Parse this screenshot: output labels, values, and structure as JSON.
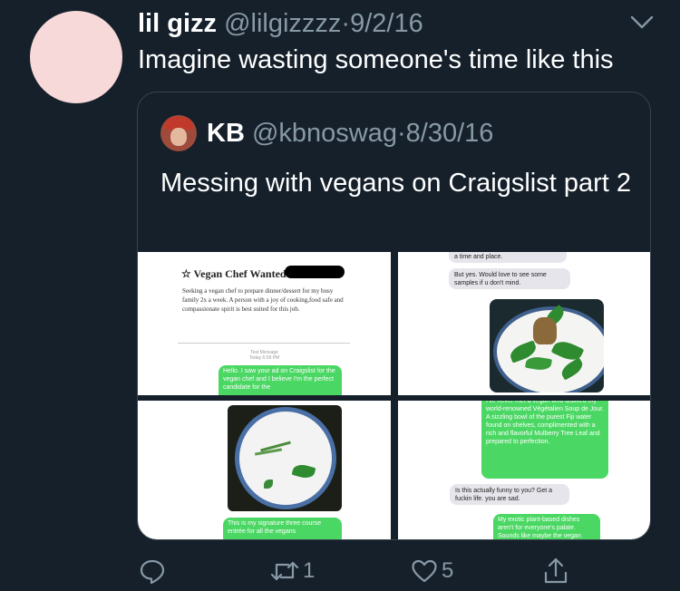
{
  "tweet": {
    "name": "lil gizz",
    "handle": "@lilgizzzz",
    "separator": "·",
    "date": "9/2/16",
    "text": "Imagine wasting someone's time like this"
  },
  "quoted": {
    "name": "KB",
    "handle": "@kbnoswag",
    "separator": "·",
    "date": "8/30/16",
    "text": "Messing with vegans on Craigslist part 2"
  },
  "images": {
    "panel1": {
      "ad_title": "Vegan Chef Wanted!",
      "ad_body": "Seeking a vegan chef to prepare dinner/dessert for my busy family 2x a week. A person with a joy of cooking,food safe and compassionate spirit is best suited for this job.",
      "timestamp_label": "Text Message",
      "timestamp_time": "Today 6:59 PM",
      "bubble": "Hello. I saw your ad on Craigslist for the vegan chef and I believe I'm the perfect candidate for the"
    },
    "panel2": {
      "cut_bubble": "a time and place.",
      "bubble": "But yes. Would love to see some samples if u don't mind."
    },
    "panel3": {
      "bubble": "This is my signature three course entrée for all the vegans"
    },
    "panel4": {
      "bubble_green_1": "I've never met a vegan who disliked my world-renowned Végétalien Soup de Jour. A sizzling bowl of the purest Fiji water found on shelves, complimented with a rich and flavorful Mulberry Tree Leaf and prepared to perfection.",
      "bubble_gray": "Is this actually funny to you? Get a fuckin life. you are sad.",
      "bubble_green_2": "My exotic plant-based dishes aren't for everyone's palate. Sounds like maybe the vegan"
    }
  },
  "actions": {
    "retweet_count": "1",
    "like_count": "5"
  },
  "colors": {
    "background": "#15202b",
    "secondary_text": "#8899a6",
    "border": "#38444d",
    "imessage_green": "#4bd763"
  }
}
